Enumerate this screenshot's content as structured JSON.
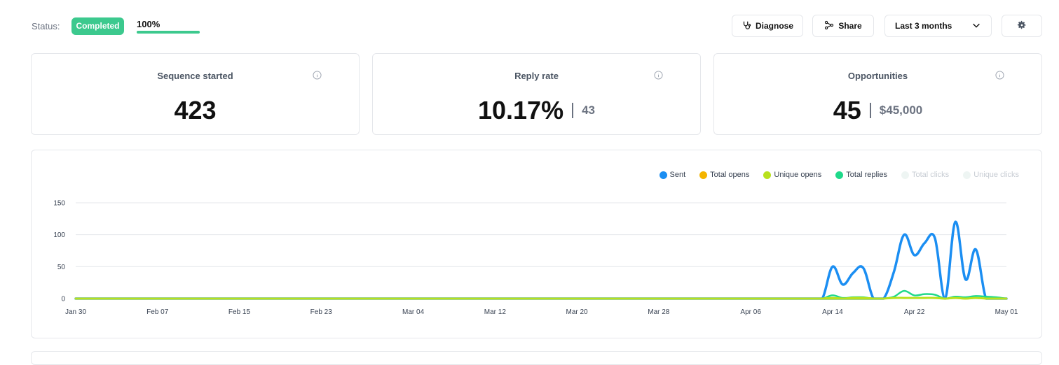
{
  "status": {
    "label": "Status:",
    "badge": "Completed",
    "progress_text": "100%",
    "progress_fraction": 1.0,
    "colors": {
      "badge": "#3cc98e",
      "progress": "#3cc98e"
    }
  },
  "toolbar": {
    "diagnose_label": "Diagnose",
    "diagnose_icon": "stethoscope-icon",
    "share_label": "Share",
    "share_icon": "share-nodes-icon",
    "range_label": "Last 3 months",
    "range_icon": "chevron-down-icon",
    "settings_icon": "gear-icon"
  },
  "metrics": [
    {
      "title": "Sequence started",
      "value": "423",
      "secondary": ""
    },
    {
      "title": "Reply rate",
      "value": "10.17%",
      "secondary": "43"
    },
    {
      "title": "Opportunities",
      "value": "45",
      "secondary": "$45,000"
    }
  ],
  "chart_data": {
    "type": "line",
    "title": "",
    "xlabel": "",
    "ylabel": "",
    "ylim": [
      0,
      150
    ],
    "yticks": [
      0,
      50,
      100,
      150
    ],
    "grid": true,
    "legend_position": "top-right",
    "xtick_labels": [
      "Jan 30",
      "Feb 07",
      "Feb 15",
      "Feb 23",
      "Mar 04",
      "Mar 12",
      "Mar 20",
      "Mar 28",
      "Apr 06",
      "Apr 14",
      "Apr 22",
      "May 01"
    ],
    "x": [
      "Apr 12",
      "Apr 13",
      "Apr 14",
      "Apr 15",
      "Apr 16",
      "Apr 17",
      "Apr 18",
      "Apr 19",
      "Apr 20",
      "Apr 21",
      "Apr 22",
      "Apr 23",
      "Apr 24",
      "Apr 25",
      "Apr 26",
      "Apr 27",
      "Apr 28",
      "Apr 29",
      "Apr 30",
      "May 01"
    ],
    "series": [
      {
        "name": "Sent",
        "color": "#1b8ef2",
        "active": true,
        "values": [
          0,
          0,
          50,
          22,
          40,
          48,
          0,
          0,
          42,
          100,
          68,
          87,
          95,
          0,
          120,
          30,
          77,
          0,
          0,
          0
        ]
      },
      {
        "name": "Total opens",
        "color": "#f4b400",
        "active": true,
        "values": [
          0,
          0,
          1,
          0,
          1,
          1,
          0,
          0,
          1,
          1,
          1,
          1,
          1,
          0,
          1,
          0,
          1,
          0,
          0,
          0
        ]
      },
      {
        "name": "Unique opens",
        "color": "#b8e11d",
        "active": true,
        "values": [
          0,
          0,
          1,
          0,
          1,
          1,
          0,
          0,
          1,
          1,
          1,
          1,
          1,
          0,
          1,
          0,
          1,
          0,
          0,
          0
        ]
      },
      {
        "name": "Total replies",
        "color": "#1fd98a",
        "active": true,
        "values": [
          0,
          0,
          5,
          1,
          2,
          2,
          0,
          0,
          3,
          12,
          5,
          7,
          6,
          0,
          3,
          2,
          4,
          3,
          2,
          0
        ]
      },
      {
        "name": "Total clicks",
        "color": "#e8f3f0",
        "active": false,
        "values": []
      },
      {
        "name": "Unique clicks",
        "color": "#e8f3f0",
        "active": false,
        "values": []
      }
    ]
  }
}
